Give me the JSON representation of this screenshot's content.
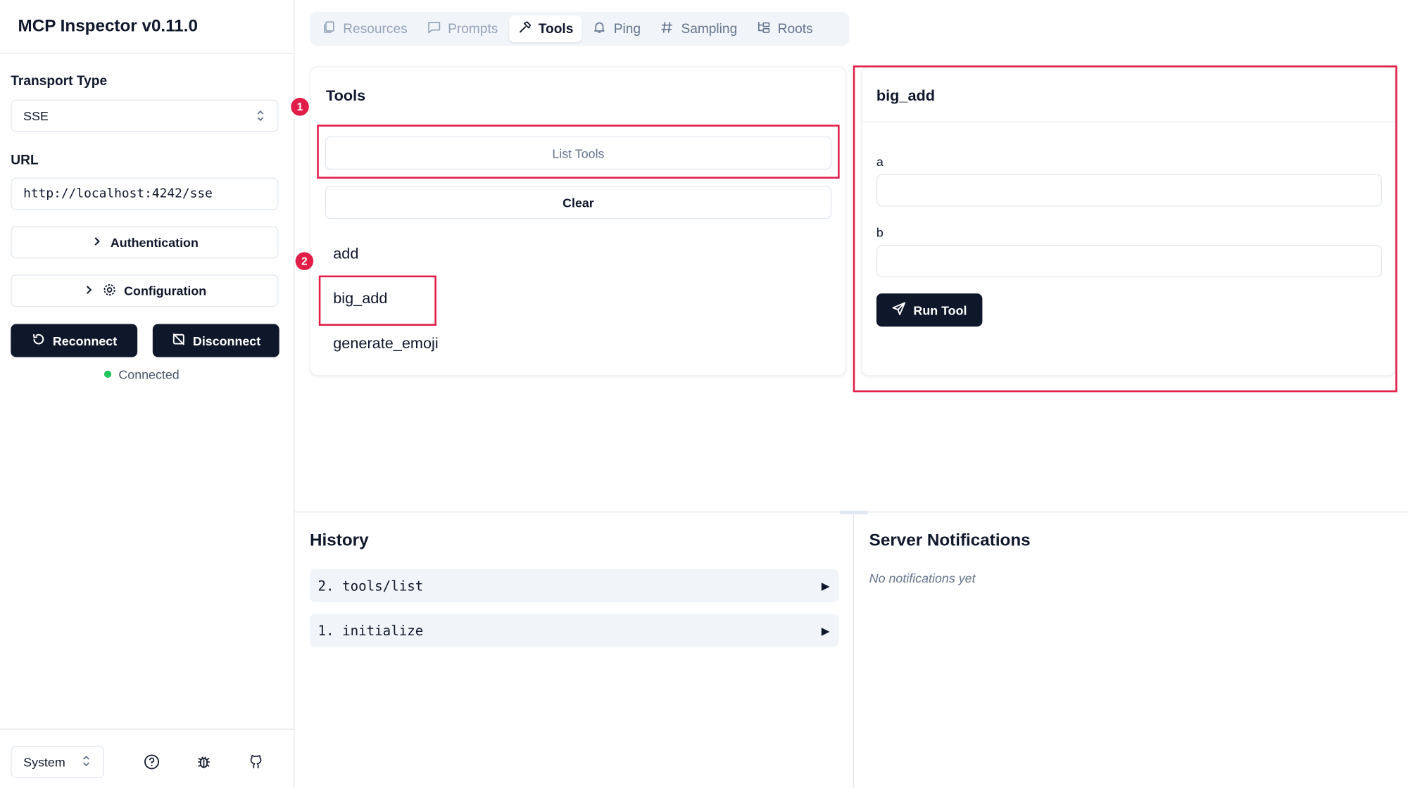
{
  "app": {
    "title": "MCP Inspector v0.11.0"
  },
  "sidebar": {
    "transport_label": "Transport Type",
    "transport_value": "SSE",
    "url_label": "URL",
    "url_value": "http://localhost:4242/sse",
    "authentication_label": "Authentication",
    "configuration_label": "Configuration",
    "reconnect_label": "Reconnect",
    "disconnect_label": "Disconnect",
    "status_text": "Connected",
    "status_color": "#22c55e",
    "theme_value": "System"
  },
  "tabs": [
    {
      "label": "Resources",
      "icon": "files-icon",
      "state": "disabled"
    },
    {
      "label": "Prompts",
      "icon": "message-square-icon",
      "state": "disabled"
    },
    {
      "label": "Tools",
      "icon": "hammer-icon",
      "state": "active"
    },
    {
      "label": "Ping",
      "icon": "bell-icon",
      "state": "normal"
    },
    {
      "label": "Sampling",
      "icon": "hash-icon",
      "state": "normal"
    },
    {
      "label": "Roots",
      "icon": "folder-tree-icon",
      "state": "normal"
    }
  ],
  "tools_panel": {
    "title": "Tools",
    "list_tools_label": "List Tools",
    "clear_label": "Clear",
    "items": [
      "add",
      "big_add",
      "generate_emoji"
    ]
  },
  "tool_detail": {
    "title": "big_add",
    "param_a_label": "a",
    "param_a_value": "",
    "param_b_label": "b",
    "param_b_value": "",
    "run_label": "Run Tool"
  },
  "annotations": {
    "badge_1": "1",
    "badge_2": "2",
    "highlight_color": "#e11d48"
  },
  "history": {
    "title": "History",
    "items": [
      {
        "number": "2.",
        "method": "tools/list"
      },
      {
        "number": "1.",
        "method": "initialize"
      }
    ]
  },
  "notifications": {
    "title": "Server Notifications",
    "empty_text": "No notifications yet"
  },
  "colors": {
    "primary_dark": "#0f172a",
    "muted": "#64748b",
    "border": "#e2e8f0"
  }
}
